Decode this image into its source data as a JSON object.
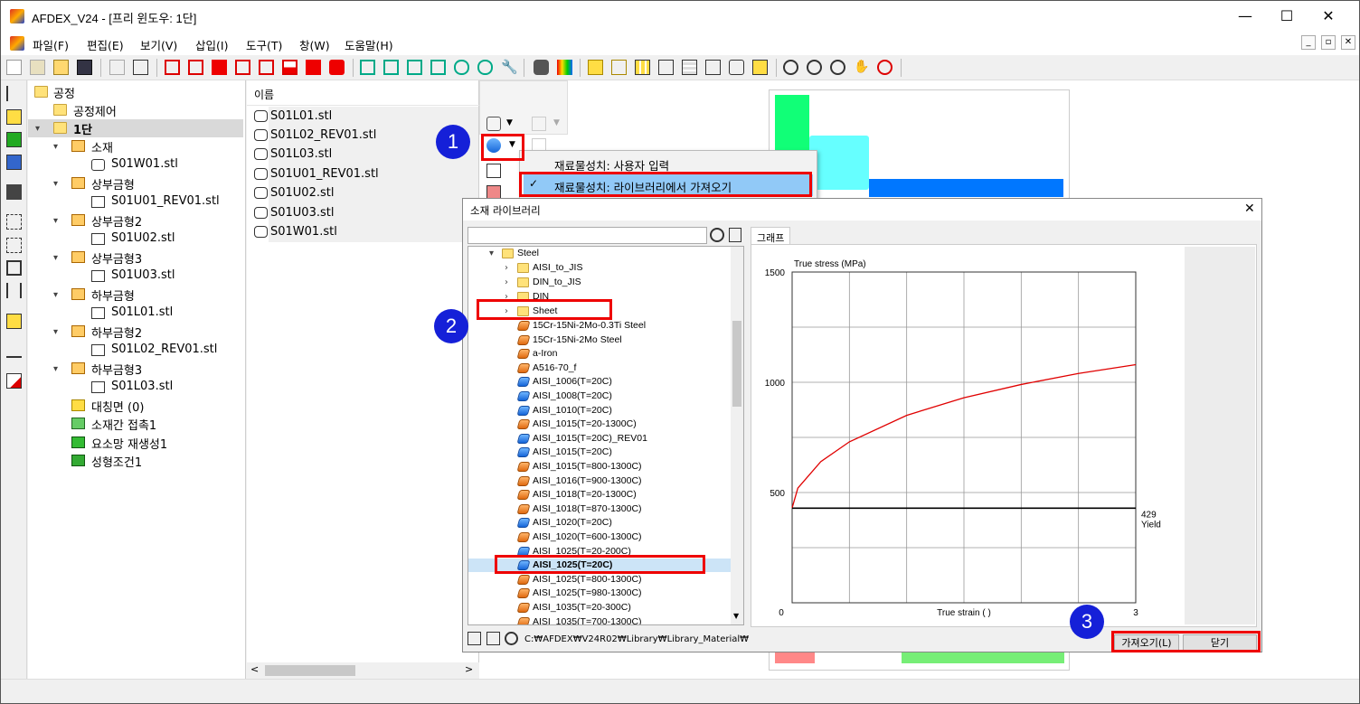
{
  "app": {
    "title": "AFDEX_V24 - [프리 윈도우: 1단]",
    "window_controls": {
      "minimize": "—",
      "maximize": "☐",
      "close": "✕"
    },
    "mdi_controls": {
      "minimize": "_",
      "restore": "▫",
      "close": "✕"
    }
  },
  "menu": [
    "파일(F)",
    "편집(E)",
    "보기(V)",
    "삽입(I)",
    "도구(T)",
    "창(W)",
    "도움말(H)"
  ],
  "tree": {
    "root": "공정",
    "items": [
      {
        "label": "공정제어"
      },
      {
        "label": "1단"
      },
      {
        "label": "소재"
      },
      {
        "label": "S01W01.stl"
      },
      {
        "label": "상부금형"
      },
      {
        "label": "S01U01_REV01.stl"
      },
      {
        "label": "상부금형2"
      },
      {
        "label": "S01U02.stl"
      },
      {
        "label": "상부금형3"
      },
      {
        "label": "S01U03.stl"
      },
      {
        "label": "하부금형"
      },
      {
        "label": "S01L01.stl"
      },
      {
        "label": "하부금형2"
      },
      {
        "label": "S01L02_REV01.stl"
      },
      {
        "label": "하부금형3"
      },
      {
        "label": "S01L03.stl"
      },
      {
        "label": "대칭면 (0)"
      },
      {
        "label": "소재간 접촉1"
      },
      {
        "label": "요소망 재생성1"
      },
      {
        "label": "성형조건1"
      }
    ]
  },
  "file_list": {
    "header": "이름",
    "items": [
      "S01L01.stl",
      "S01L02_REV01.stl",
      "S01L03.stl",
      "S01U01_REV01.stl",
      "S01U02.stl",
      "S01U03.stl",
      "S01W01.stl"
    ]
  },
  "popup_menu": {
    "item1": "재료물성치: 사용자 입력",
    "item2": "재료물성치: 라이브러리에서 가져오기",
    "check": "✓"
  },
  "badges": {
    "b1": "1",
    "b2": "2",
    "b3": "3"
  },
  "dialog": {
    "title": "소재 라이브러리",
    "close": "✕",
    "tab": "그래프",
    "path": "C:₩AFDEX₩V24R02₩Library₩Library_Material₩",
    "import_button": "가져오기(L)",
    "close_button": "닫기",
    "folder_root": "Steel",
    "folders": [
      "AISI_to_JIS",
      "DIN_to_JIS",
      "DIN",
      "Sheet"
    ],
    "materials": [
      {
        "name": "15Cr-15Ni-2Mo-0.3Ti Steel",
        "color": "orange"
      },
      {
        "name": "15Cr-15Ni-2Mo Steel",
        "color": "orange"
      },
      {
        "name": "a-Iron",
        "color": "orange"
      },
      {
        "name": "A516-70_f",
        "color": "orange"
      },
      {
        "name": "AISI_1006(T=20C)",
        "color": "blue"
      },
      {
        "name": "AISI_1008(T=20C)",
        "color": "blue"
      },
      {
        "name": "AISI_1010(T=20C)",
        "color": "blue"
      },
      {
        "name": "AISI_1015(T=20-1300C)",
        "color": "orange"
      },
      {
        "name": "AISI_1015(T=20C)_REV01",
        "color": "blue"
      },
      {
        "name": "AISI_1015(T=20C)",
        "color": "blue"
      },
      {
        "name": "AISI_1015(T=800-1300C)",
        "color": "orange"
      },
      {
        "name": "AISI_1016(T=900-1300C)",
        "color": "orange"
      },
      {
        "name": "AISI_1018(T=20-1300C)",
        "color": "orange"
      },
      {
        "name": "AISI_1018(T=870-1300C)",
        "color": "orange"
      },
      {
        "name": "AISI_1020(T=20C)",
        "color": "blue"
      },
      {
        "name": "AISI_1020(T=600-1300C)",
        "color": "orange"
      },
      {
        "name": "AISI_1025(T=20-200C)",
        "color": "blue"
      },
      {
        "name": "AISI_1025(T=20C)",
        "color": "blue"
      },
      {
        "name": "AISI_1025(T=800-1300C)",
        "color": "orange"
      },
      {
        "name": "AISI_1025(T=980-1300C)",
        "color": "orange"
      },
      {
        "name": "AISI_1035(T=20-300C)",
        "color": "orange"
      },
      {
        "name": "AISI_1035(T=700-1300C)",
        "color": "orange"
      }
    ],
    "selected_material": "AISI_1025(T=20C)"
  },
  "chart_data": {
    "type": "line",
    "ylabel": "True stress (MPa)",
    "xlabel": "True strain (  )",
    "xlim": [
      0,
      3
    ],
    "ylim": [
      0,
      1500
    ],
    "x_ticks": [
      "0",
      "3"
    ],
    "y_ticks": [
      "500",
      "1000",
      "1500"
    ],
    "grid": true,
    "series": [
      {
        "color": "#e00000",
        "x": [
          0,
          0.05,
          0.25,
          0.5,
          1.0,
          1.5,
          2.0,
          2.5,
          3.0
        ],
        "y": [
          430,
          520,
          640,
          730,
          850,
          930,
          990,
          1040,
          1080
        ]
      },
      {
        "color": "#000000",
        "x": [
          0,
          3
        ],
        "y": [
          429,
          429
        ]
      }
    ],
    "annotation": {
      "value": "429",
      "label": "Yield"
    }
  },
  "colors": {
    "accent_red": "#e00000",
    "badge_blue": "#1520d8",
    "selection": "#cce4f7"
  }
}
